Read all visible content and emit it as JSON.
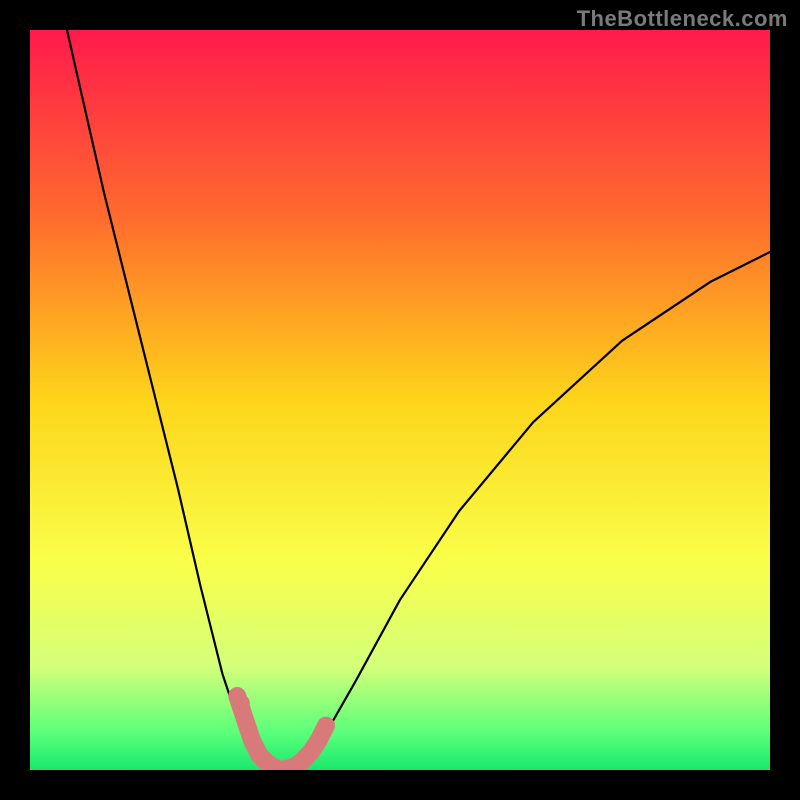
{
  "watermark": "TheBottleneck.com",
  "chart_data": {
    "type": "line",
    "title": "",
    "xlabel": "",
    "ylabel": "",
    "xlim": [
      0,
      100
    ],
    "ylim": [
      0,
      100
    ],
    "grid": false,
    "legend": false,
    "background_gradient": {
      "stops": [
        {
          "pct": 0,
          "color": "#ff1a4c"
        },
        {
          "pct": 25,
          "color": "#ff6a2d"
        },
        {
          "pct": 50,
          "color": "#fdd51a"
        },
        {
          "pct": 72,
          "color": "#f9ff4a"
        },
        {
          "pct": 86,
          "color": "#d4ff7a"
        },
        {
          "pct": 95,
          "color": "#5aff7a"
        },
        {
          "pct": 100,
          "color": "#18e86f"
        }
      ]
    },
    "series": [
      {
        "name": "bottleneck-curve-left",
        "color": "#000000",
        "x": [
          5,
          10,
          15,
          20,
          23,
          26,
          28,
          30,
          31,
          32,
          33,
          34
        ],
        "values": [
          100,
          78,
          58,
          38,
          25,
          13,
          7,
          3,
          1.5,
          0.8,
          0.3,
          0
        ]
      },
      {
        "name": "bottleneck-curve-right",
        "color": "#000000",
        "x": [
          34,
          36,
          38,
          40,
          44,
          50,
          58,
          68,
          80,
          92,
          100
        ],
        "values": [
          0,
          0.5,
          2,
          5,
          12,
          23,
          35,
          47,
          58,
          66,
          70
        ]
      },
      {
        "name": "highlight-dip",
        "color": "#d97a7a",
        "x": [
          28,
          30,
          31,
          32,
          33,
          34,
          35,
          36,
          37,
          38,
          39,
          40
        ],
        "values": [
          10,
          4,
          2,
          1,
          0.3,
          0,
          0.2,
          0.6,
          1.4,
          2.5,
          4,
          6
        ]
      }
    ],
    "markers": [
      {
        "name": "highlight-dot-left",
        "x": 28.5,
        "y": 9,
        "color": "#d97a7a"
      }
    ]
  }
}
